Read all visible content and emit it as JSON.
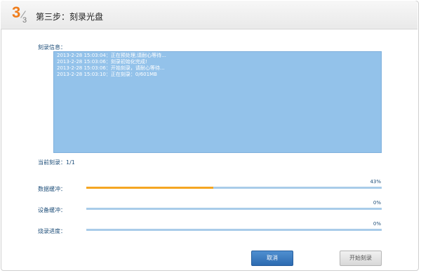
{
  "header": {
    "step_number": "3",
    "step_total": "3",
    "title": "第三步：刻录光盘"
  },
  "log": {
    "label": "刻录信息：",
    "lines": [
      "2013-2-28 15:03:04：正在预处理,请耐心等待...",
      "2013-2-28 15:03:06：刻录初始化完成!",
      "2013-2-28 15:03:06：开始刻录，请耐心等待...",
      "2013-2-28 15:03:10：正在刻录：0/601MB"
    ]
  },
  "current": {
    "label": "当前刻录：1/1"
  },
  "progress": {
    "data_buffer": {
      "label": "数据缓冲：",
      "percent_text": "43%",
      "value": 0.43
    },
    "device_buffer": {
      "label": "设备缓冲：",
      "percent_text": "0%",
      "value": 0
    },
    "burn_progress": {
      "label": "烧录进度：",
      "percent_text": "0%",
      "value": 0
    }
  },
  "buttons": {
    "cancel": "取消",
    "start": "开始刻录"
  },
  "colors": {
    "accent": "#ef7d1c",
    "log_bg": "#93c2ea",
    "bar_track": "#a9cce9",
    "bar_fill": "#f5a623",
    "primary_button": "#2d6bb1"
  }
}
